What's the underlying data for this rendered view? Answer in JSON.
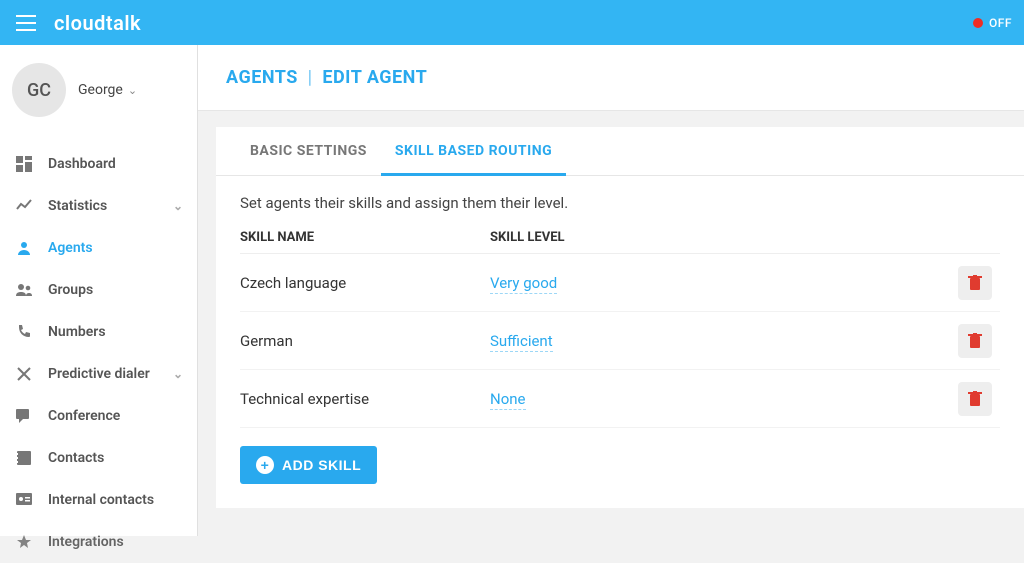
{
  "brand": "cloudtalk",
  "status": {
    "label": "OFF"
  },
  "user": {
    "initials": "GC",
    "name": "George"
  },
  "sidebar": {
    "items": [
      {
        "label": "Dashboard",
        "icon": "dashboard",
        "expandable": false
      },
      {
        "label": "Statistics",
        "icon": "stats",
        "expandable": true
      },
      {
        "label": "Agents",
        "icon": "agent",
        "expandable": false,
        "active": true
      },
      {
        "label": "Groups",
        "icon": "groups",
        "expandable": false
      },
      {
        "label": "Numbers",
        "icon": "phone",
        "expandable": false
      },
      {
        "label": "Predictive dialer",
        "icon": "dialer",
        "expandable": true
      },
      {
        "label": "Conference",
        "icon": "conference",
        "expandable": false
      },
      {
        "label": "Contacts",
        "icon": "contacts",
        "expandable": false
      },
      {
        "label": "Internal contacts",
        "icon": "internal",
        "expandable": false
      },
      {
        "label": "Integrations",
        "icon": "integrations",
        "expandable": false
      }
    ]
  },
  "breadcrumb": {
    "root": "AGENTS",
    "page": "EDIT AGENT"
  },
  "tabs": [
    {
      "label": "BASIC SETTINGS",
      "active": false
    },
    {
      "label": "SKILL BASED ROUTING",
      "active": true
    }
  ],
  "skillsPanel": {
    "description": "Set agents their skills and assign them their level.",
    "headers": {
      "name": "SKILL NAME",
      "level": "SKILL LEVEL"
    },
    "rows": [
      {
        "name": "Czech language",
        "level": "Very good"
      },
      {
        "name": "German",
        "level": "Sufficient"
      },
      {
        "name": "Technical expertise",
        "level": "None"
      }
    ],
    "addButton": "ADD SKILL"
  }
}
